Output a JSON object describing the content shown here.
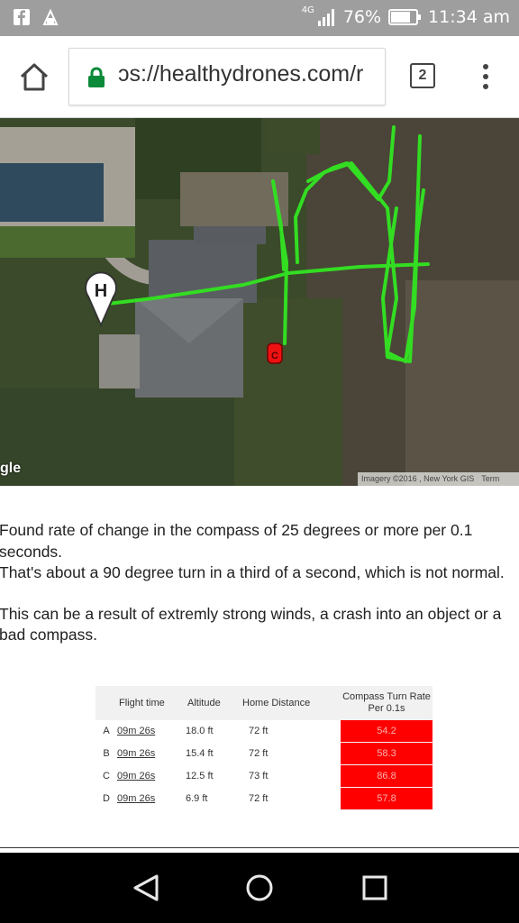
{
  "status_bar": {
    "network_type": "4G",
    "battery": "76%",
    "time": "11:34 am",
    "icons": [
      "facebook-icon",
      "alarm-icon",
      "signal-icon",
      "battery-icon"
    ]
  },
  "browser": {
    "url_text": "ɔs://healthydrones.com/r",
    "tab_count": "2",
    "icons": [
      "home-icon",
      "lock-icon",
      "menu-icon"
    ],
    "lock_color": "#0b8a3a"
  },
  "map": {
    "logo_text": "gle",
    "attribution": "Imagery ©2016 , New York GIS",
    "terms": "Term",
    "home_marker": "H",
    "compass_marker": "C",
    "track_color": "#33dd22"
  },
  "message": {
    "line1": "Found rate of change in the compass of 25 degrees or more per 0.1 seconds.",
    "line2": "That's about a 90 degree turn in a third of a second, which is not normal.",
    "line3": "This can be a result of extremly strong winds, a crash into an object or a bad compass."
  },
  "table": {
    "headers": {
      "flight_time": "Flight time",
      "altitude": "Altitude",
      "home_distance": "Home Distance",
      "compass_rate": "Compass Turn Rate Per 0.1s"
    },
    "rows": [
      {
        "id": "A",
        "time": "09m 26s",
        "altitude": "18.0 ft",
        "home": "72 ft",
        "rate": "54.2"
      },
      {
        "id": "B",
        "time": "09m 26s",
        "altitude": "15.4 ft",
        "home": "72 ft",
        "rate": "58.3"
      },
      {
        "id": "C",
        "time": "09m 26s",
        "altitude": "12.5 ft",
        "home": "73 ft",
        "rate": "86.8"
      },
      {
        "id": "D",
        "time": "09m 26s",
        "altitude": "6.9 ft",
        "home": "72 ft",
        "rate": "57.8"
      }
    ],
    "highlight_color": "#ff0000"
  },
  "nav_bar": {
    "icons": [
      "back-icon",
      "home-circle-icon",
      "recents-icon"
    ]
  }
}
